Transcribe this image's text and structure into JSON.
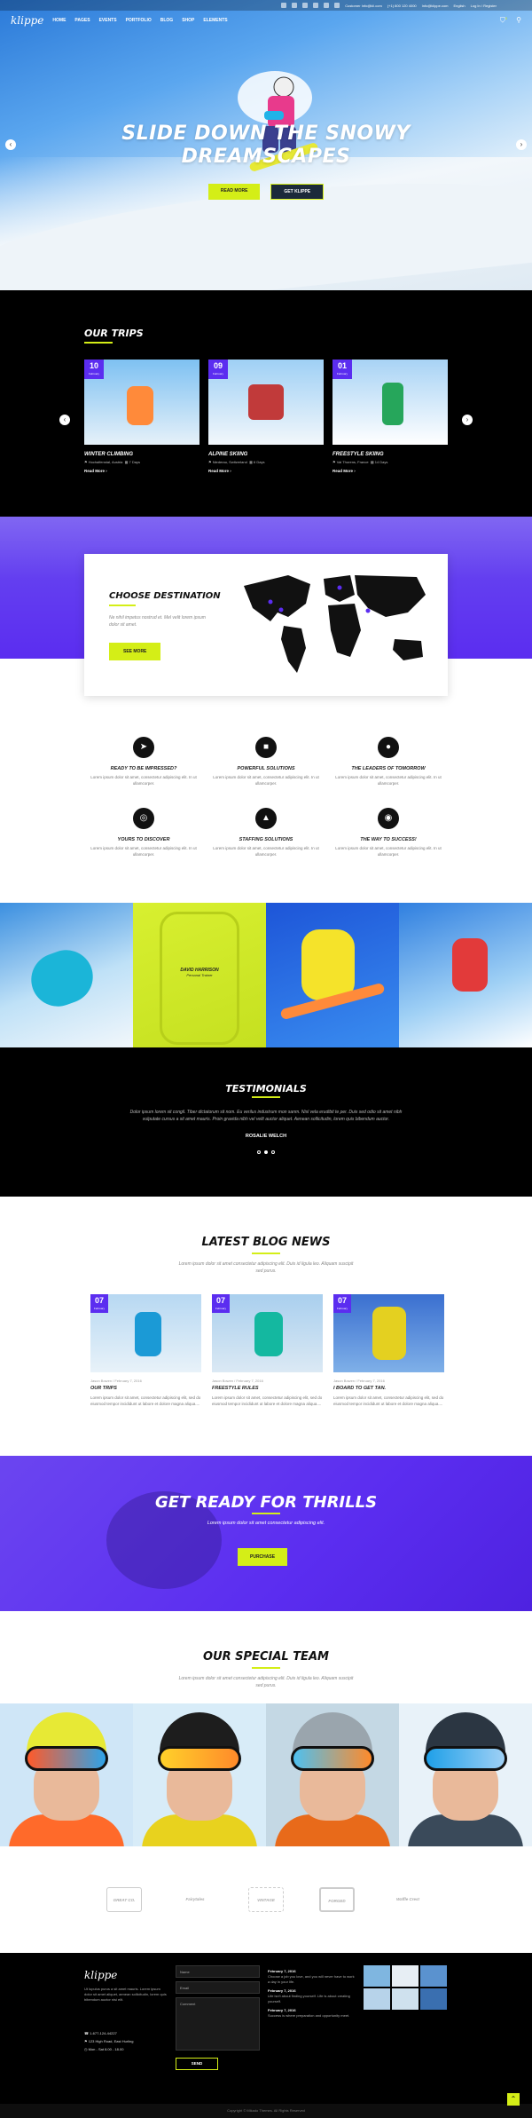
{
  "topbar": {
    "social_count": 6,
    "email": "Customer Info@kli.com",
    "phone": "(+1) 800 120 4000",
    "mail2": "Info@klippe.com",
    "lang": "English",
    "login": "Log In / Register"
  },
  "header": {
    "logo": "klippe",
    "menu": [
      "HOME",
      "PAGES",
      "EVENTS",
      "PORTFOLIO",
      "BLOG",
      "SHOP",
      "ELEMENTS"
    ],
    "cart_count": "0"
  },
  "hero": {
    "title_line1": "SLIDE DOWN THE SNOWY",
    "title_line2": "DREAMSCAPES",
    "btn_primary": "READ MORE",
    "btn_secondary": "GET KLIPPE"
  },
  "trips": {
    "title": "OUR TRIPS",
    "items": [
      {
        "day": "10",
        "month": "February",
        "name": "WINTER CLIMBING",
        "location": "Hochalfenstal, Austria",
        "days": "7 Days",
        "more": "Read More",
        "img": [
          "#ff8a3a",
          "#7ec1f2"
        ]
      },
      {
        "day": "09",
        "month": "February",
        "name": "ALPINE SKIING",
        "location": "Niederau, Switzerland",
        "days": "6 Days",
        "more": "Read More",
        "img": [
          "#c13a3a",
          "#9fd0f5"
        ]
      },
      {
        "day": "01",
        "month": "February",
        "name": "FREESTYLE SKIING",
        "location": "Val Thorens, France",
        "days": "14 Days",
        "more": "Read More",
        "img": [
          "#26a65b",
          "#a8d3f5"
        ]
      }
    ]
  },
  "destination": {
    "title": "CHOOSE DESTINATION",
    "text": "Ne nihil impetus nostrud et. Mel velit lorem ipsum dolor sit amet.",
    "button": "SEE MORE"
  },
  "features": [
    {
      "icon": "rocket-icon",
      "glyph": "➤",
      "title": "READY TO BE IMPRESSED?",
      "text": "Lorem ipsum dolor sit amet, consectetur adipiscing elit. In ut ullamcorper."
    },
    {
      "icon": "briefcase-icon",
      "glyph": "■",
      "title": "POWERFUL SOLUTIONS",
      "text": "Lorem ipsum dolor sit amet, consectetur adipiscing elit. In ut ullamcorper."
    },
    {
      "icon": "chat-icon",
      "glyph": "●",
      "title": "THE LEADERS OF TOMORROW",
      "text": "Lorem ipsum dolor sit amet, consectetur adipiscing elit. In ut ullamcorper."
    },
    {
      "icon": "binoculars-icon",
      "glyph": "◎",
      "title": "YOURS TO DISCOVER",
      "text": "Lorem ipsum dolor sit amet, consectetur adipiscing elit. In ut ullamcorper."
    },
    {
      "icon": "bell-icon",
      "glyph": "▲",
      "title": "STAFFING SOLUTIONS",
      "text": "Lorem ipsum dolor sit amet, consectetur adipiscing elit. In ut ullamcorper."
    },
    {
      "icon": "globe-icon",
      "glyph": "◉",
      "title": "THE WAY TO SUCCESS!",
      "text": "Lorem ipsum dolor sit amet, consectetur adipiscing elit. In ut ullamcorper."
    }
  ],
  "strip": [
    {
      "bg": "linear-gradient(160deg,#3b8fe0,#bfe1f7 55%,#f2f7fb)",
      "accent": "#1bb5d8"
    },
    {
      "bg": "linear-gradient(160deg,#d8f030,#c5e020)",
      "accent": "#b7cf1a",
      "name": "DAVID HARRISON",
      "role": "Personal Trainer"
    },
    {
      "bg": "linear-gradient(160deg,#1d55d8,#3a8df0)",
      "accent": "#f5e32a"
    },
    {
      "bg": "linear-gradient(160deg,#2f7fe0,#9fd0f5 60%,#ffffff)",
      "accent": "#e23a3a"
    }
  ],
  "testimonials": {
    "title": "TESTIMONIALS",
    "text": "Dolor ipsum lorem sit congil. Tiber dictatorum sit nom. Eu verilus industrum mon sanm. Nisl vela erudibit te per. Duis sed odio sit amet nibh vulputate cursus a sit amet mauris. Proin gravida nibh vel velit auctor aliquet. Aenean sollicitudin, lorem quis bibendum auctor.",
    "author": "ROSALIE WELCH",
    "dots": 3
  },
  "blog": {
    "title": "LATEST BLOG NEWS",
    "subtitle": "Lorem ipsum dolor sit amet consectetur adipiscing elit. Duis id ligula leo. Aliquam suscipit sed purus.",
    "posts": [
      {
        "day": "07",
        "month": "February",
        "meta": "Jason Bowen / February 7, 2016",
        "title": "OUR TRIPS",
        "excerpt": "Lorem ipsum dolor sit amet, consectetur adipiscing elit, sed do eiusmod tempor incididunt ut labore et dolore magna aliqua....",
        "img": [
          "#1b9ad6",
          "#e8f2f9"
        ]
      },
      {
        "day": "07",
        "month": "February",
        "meta": "Jason Bowen / February 7, 2016",
        "title": "FREESTYLE RULES",
        "excerpt": "Lorem ipsum dolor sit amet, consectetur adipiscing elit, sed do eiusmod tempor incididunt ut labore et dolore magna aliqua....",
        "img": [
          "#14b8a0",
          "#dbe9f4"
        ]
      },
      {
        "day": "07",
        "month": "February",
        "meta": "Jason Bowen / February 7, 2016",
        "title": "I BOARD TO GET TAN.",
        "excerpt": "Lorem ipsum dolor sit amet, consectetur adipiscing elit, sed do eiusmod tempor incididunt ut labore et dolore magna aliqua....",
        "img": [
          "#e4d020",
          "#3a6fd0"
        ]
      }
    ]
  },
  "cta": {
    "title": "GET READY FOR THRILLS",
    "text": "Lorem ipsum dolor sit amet consectetur adipiscing elit.",
    "button": "PURCHASE"
  },
  "team": {
    "title": "OUR SPECIAL TEAM",
    "subtitle": "Lorem ipsum dolor sit amet consectetur adipiscing elit. Duis id ligula leo. Aliquam suscipit sed purus.",
    "members": [
      {
        "helmet": "#e7e935",
        "lens": "#2ea3e8",
        "body": "#ff6a2a",
        "bg": "#cfe6f7"
      },
      {
        "helmet": "#1d1d1d",
        "lens": "#ffd12a",
        "body": "#e8d21e",
        "bg": "#d8ecf8"
      },
      {
        "helmet": "#9aa5ad",
        "lens": "#4ec0f0",
        "body": "#e86a1a",
        "bg": "#c4d8e4"
      },
      {
        "helmet": "#2b3642",
        "lens": "#1fa0e8",
        "body": "#3a4a5a",
        "bg": "#e8f2f9"
      }
    ]
  },
  "partners": [
    "GREAT CO.",
    "Fairytales",
    "VINTAGE",
    "FORGED",
    "Waffle Crest"
  ],
  "footer": {
    "logo": "klippe",
    "about": "Ut lupulus purus a sit amet mauris. Lorem ipsum dolor sit amet aliquet, aenean sollicitudin, lorem quis bibendum auctor nisi elit.",
    "phone": "1-677-124-44227",
    "address": "123 High Road, East Hurling",
    "hours": "Mon - Sat 8.00 - 18.00",
    "form": {
      "name": "Name",
      "email": "Email",
      "comment": "Comment",
      "send": "SEND"
    },
    "news": [
      {
        "date": "February 7, 2016",
        "text": "Choose a job you love, and you will never have to work a day in your life."
      },
      {
        "date": "February 7, 2016",
        "text": "Life isn't about finding yourself. Life is about creating yourself."
      },
      {
        "date": "February 7, 2016",
        "text": "Success is where preparation and opportunity meet."
      }
    ],
    "gallery": [
      "#7fb6e0",
      "#e7eef4",
      "#5a92cf",
      "#b7d3ea",
      "#cfe1ee",
      "#3a6fb0"
    ]
  },
  "copyright": "Copyright © Mikado Themes. All Rights Reserved"
}
